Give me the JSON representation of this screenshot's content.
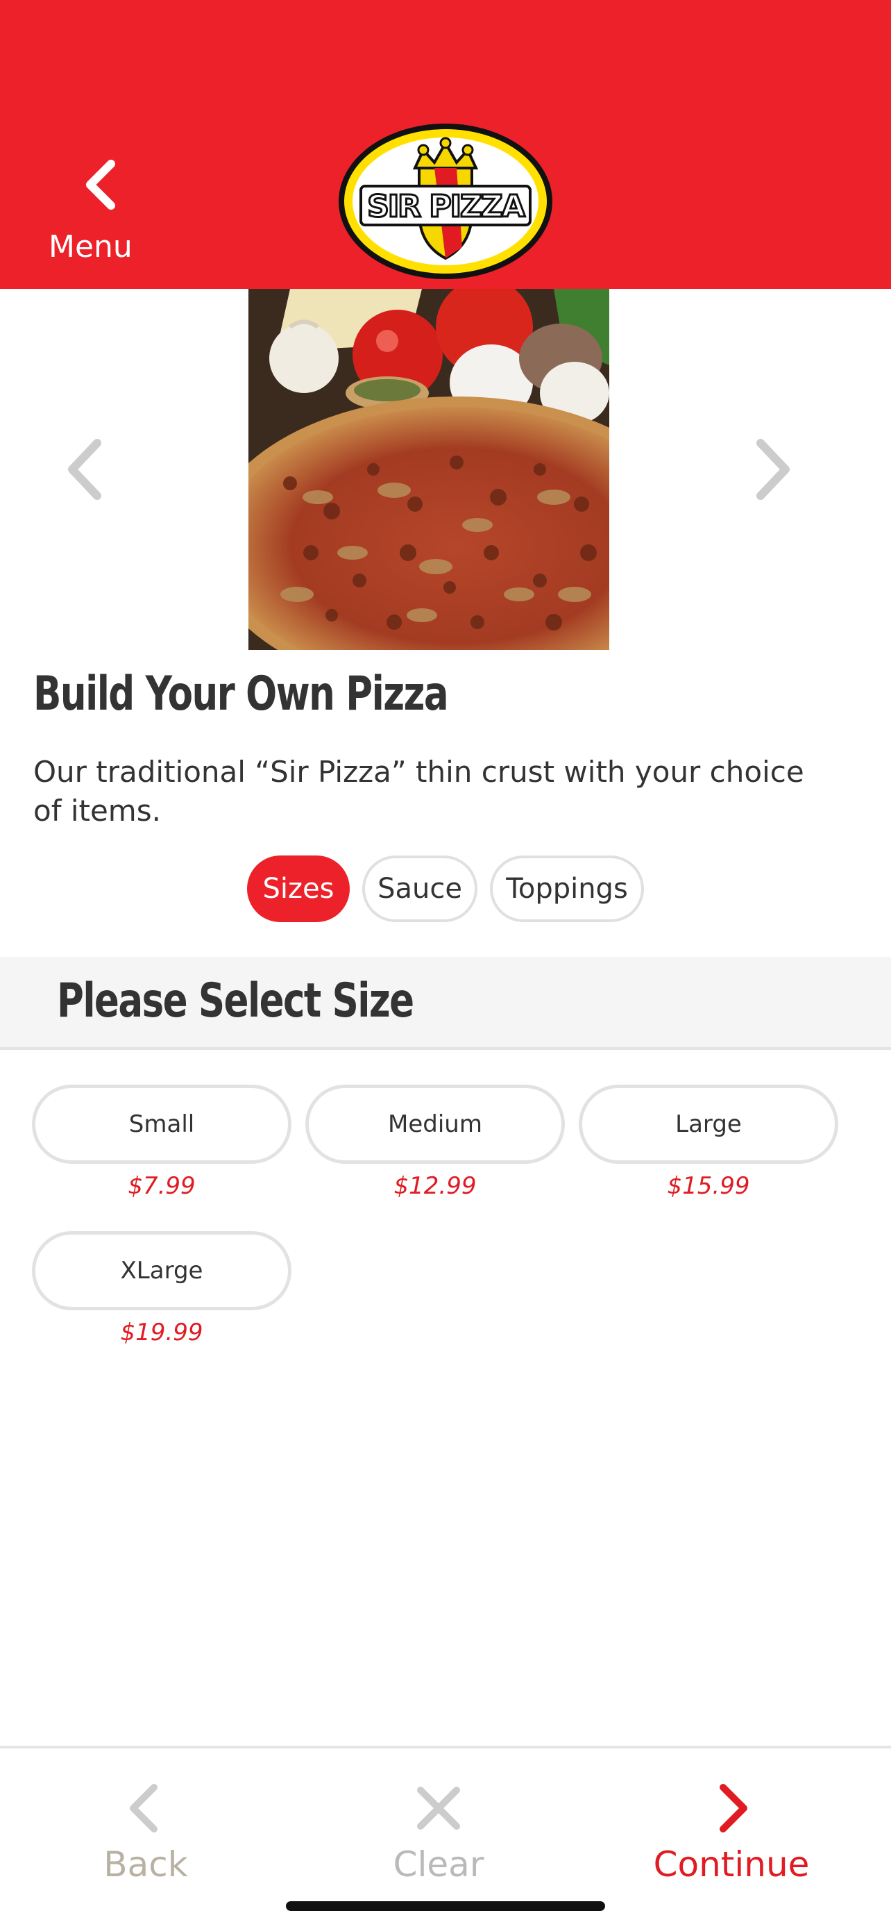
{
  "header": {
    "back_label": "Menu",
    "logo_text": "SIR PIZZA",
    "brand_color": "#ec2129"
  },
  "carousel": {
    "prev_icon": "chevron-left-icon",
    "next_icon": "chevron-right-icon",
    "image": "pizza with tomatoes, garlic, mushrooms and cheese"
  },
  "product": {
    "title": "Build Your Own Pizza",
    "description": "Our traditional “Sir Pizza” thin crust with your choice of items."
  },
  "tabs": [
    {
      "label": "Sizes",
      "active": true
    },
    {
      "label": "Sauce",
      "active": false
    },
    {
      "label": "Toppings",
      "active": false
    }
  ],
  "section": {
    "title": "Please Select Size"
  },
  "sizes": [
    {
      "label": "Small",
      "price": "$7.99"
    },
    {
      "label": "Medium",
      "price": "$12.99"
    },
    {
      "label": "Large",
      "price": "$15.99"
    },
    {
      "label": "XLarge",
      "price": "$19.99"
    }
  ],
  "bottom_nav": {
    "back": "Back",
    "clear": "Clear",
    "continue": "Continue",
    "accent": "#e01b22"
  }
}
